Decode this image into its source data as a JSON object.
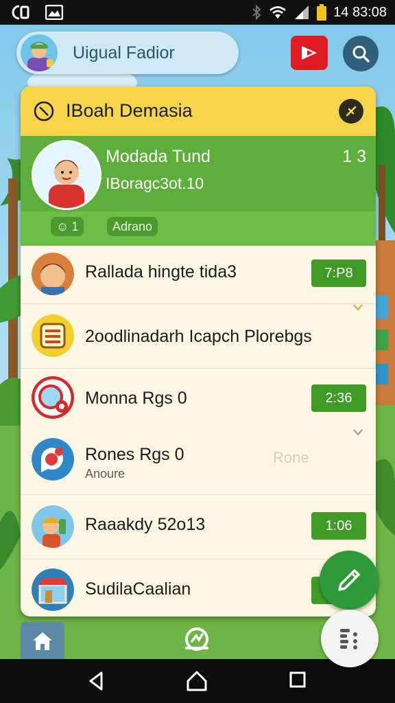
{
  "status_bar": {
    "time": "14 83:08"
  },
  "profile": {
    "name": "Uigual Fadior"
  },
  "panel": {
    "title": "IBoah Demasia",
    "featured": {
      "name": "Modada Tund",
      "count": "1 3",
      "subtitle": "IBoragc3ot.10",
      "chip1": "1",
      "chip2": "Adrano"
    },
    "items": [
      {
        "name": "Rallada hingte tida3",
        "time": "7:P8"
      },
      {
        "name": "2oodlinadarh Icapch Plorebgs"
      },
      {
        "name": "Monna Rgs 0",
        "time": "2:36"
      },
      {
        "name": "Rones Rgs 0",
        "sub": "Anoure",
        "muted": "Rone"
      },
      {
        "name": "Raaakdy 52o13",
        "time": "1:06"
      },
      {
        "name": "SudilaCaalian"
      }
    ]
  },
  "colors": {
    "header": "#f6d54a",
    "featured": "#5dae3a",
    "time_badge": "#3f9a26",
    "fab": "#2e9a3a"
  },
  "icons": [
    "wifi-icon",
    "signal-icon",
    "battery-icon",
    "bluetooth-icon",
    "search-icon",
    "play-icon",
    "close-icon",
    "edit-icon",
    "home-icon",
    "menu-icon",
    "back-icon",
    "home-nav-icon",
    "recents-icon"
  ]
}
